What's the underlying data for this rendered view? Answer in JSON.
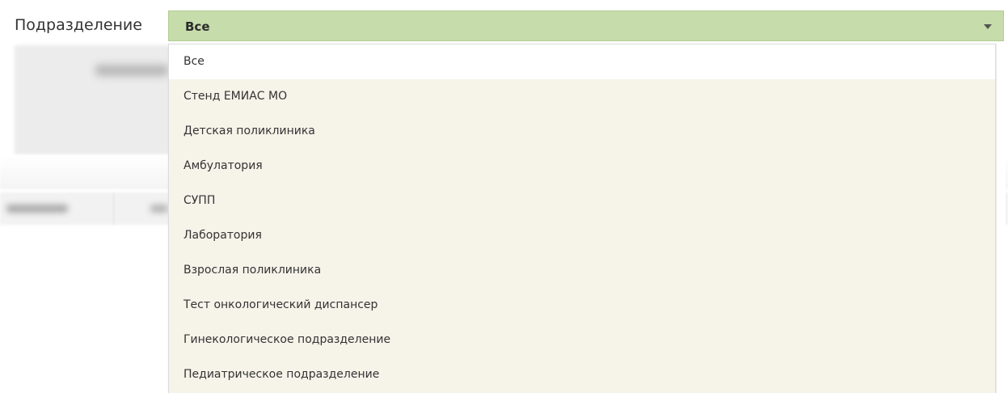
{
  "field": {
    "label": "Подразделение",
    "selected_value": "Все"
  },
  "dropdown": {
    "options": [
      "Все",
      "Стенд ЕМИАС МО",
      "Детская поликлиника",
      "Амбулатория",
      "СУПП",
      "Лаборатория",
      "Взрослая поликлиника",
      "Тест онкологический диспансер",
      "Гинекологическое подразделение",
      "Педиатрическое подразделение"
    ]
  },
  "colors": {
    "select_background": "#c6dcaa",
    "dropdown_background": "#f6f3e9"
  },
  "icons": {
    "select_arrow": "chevron-down-icon"
  }
}
